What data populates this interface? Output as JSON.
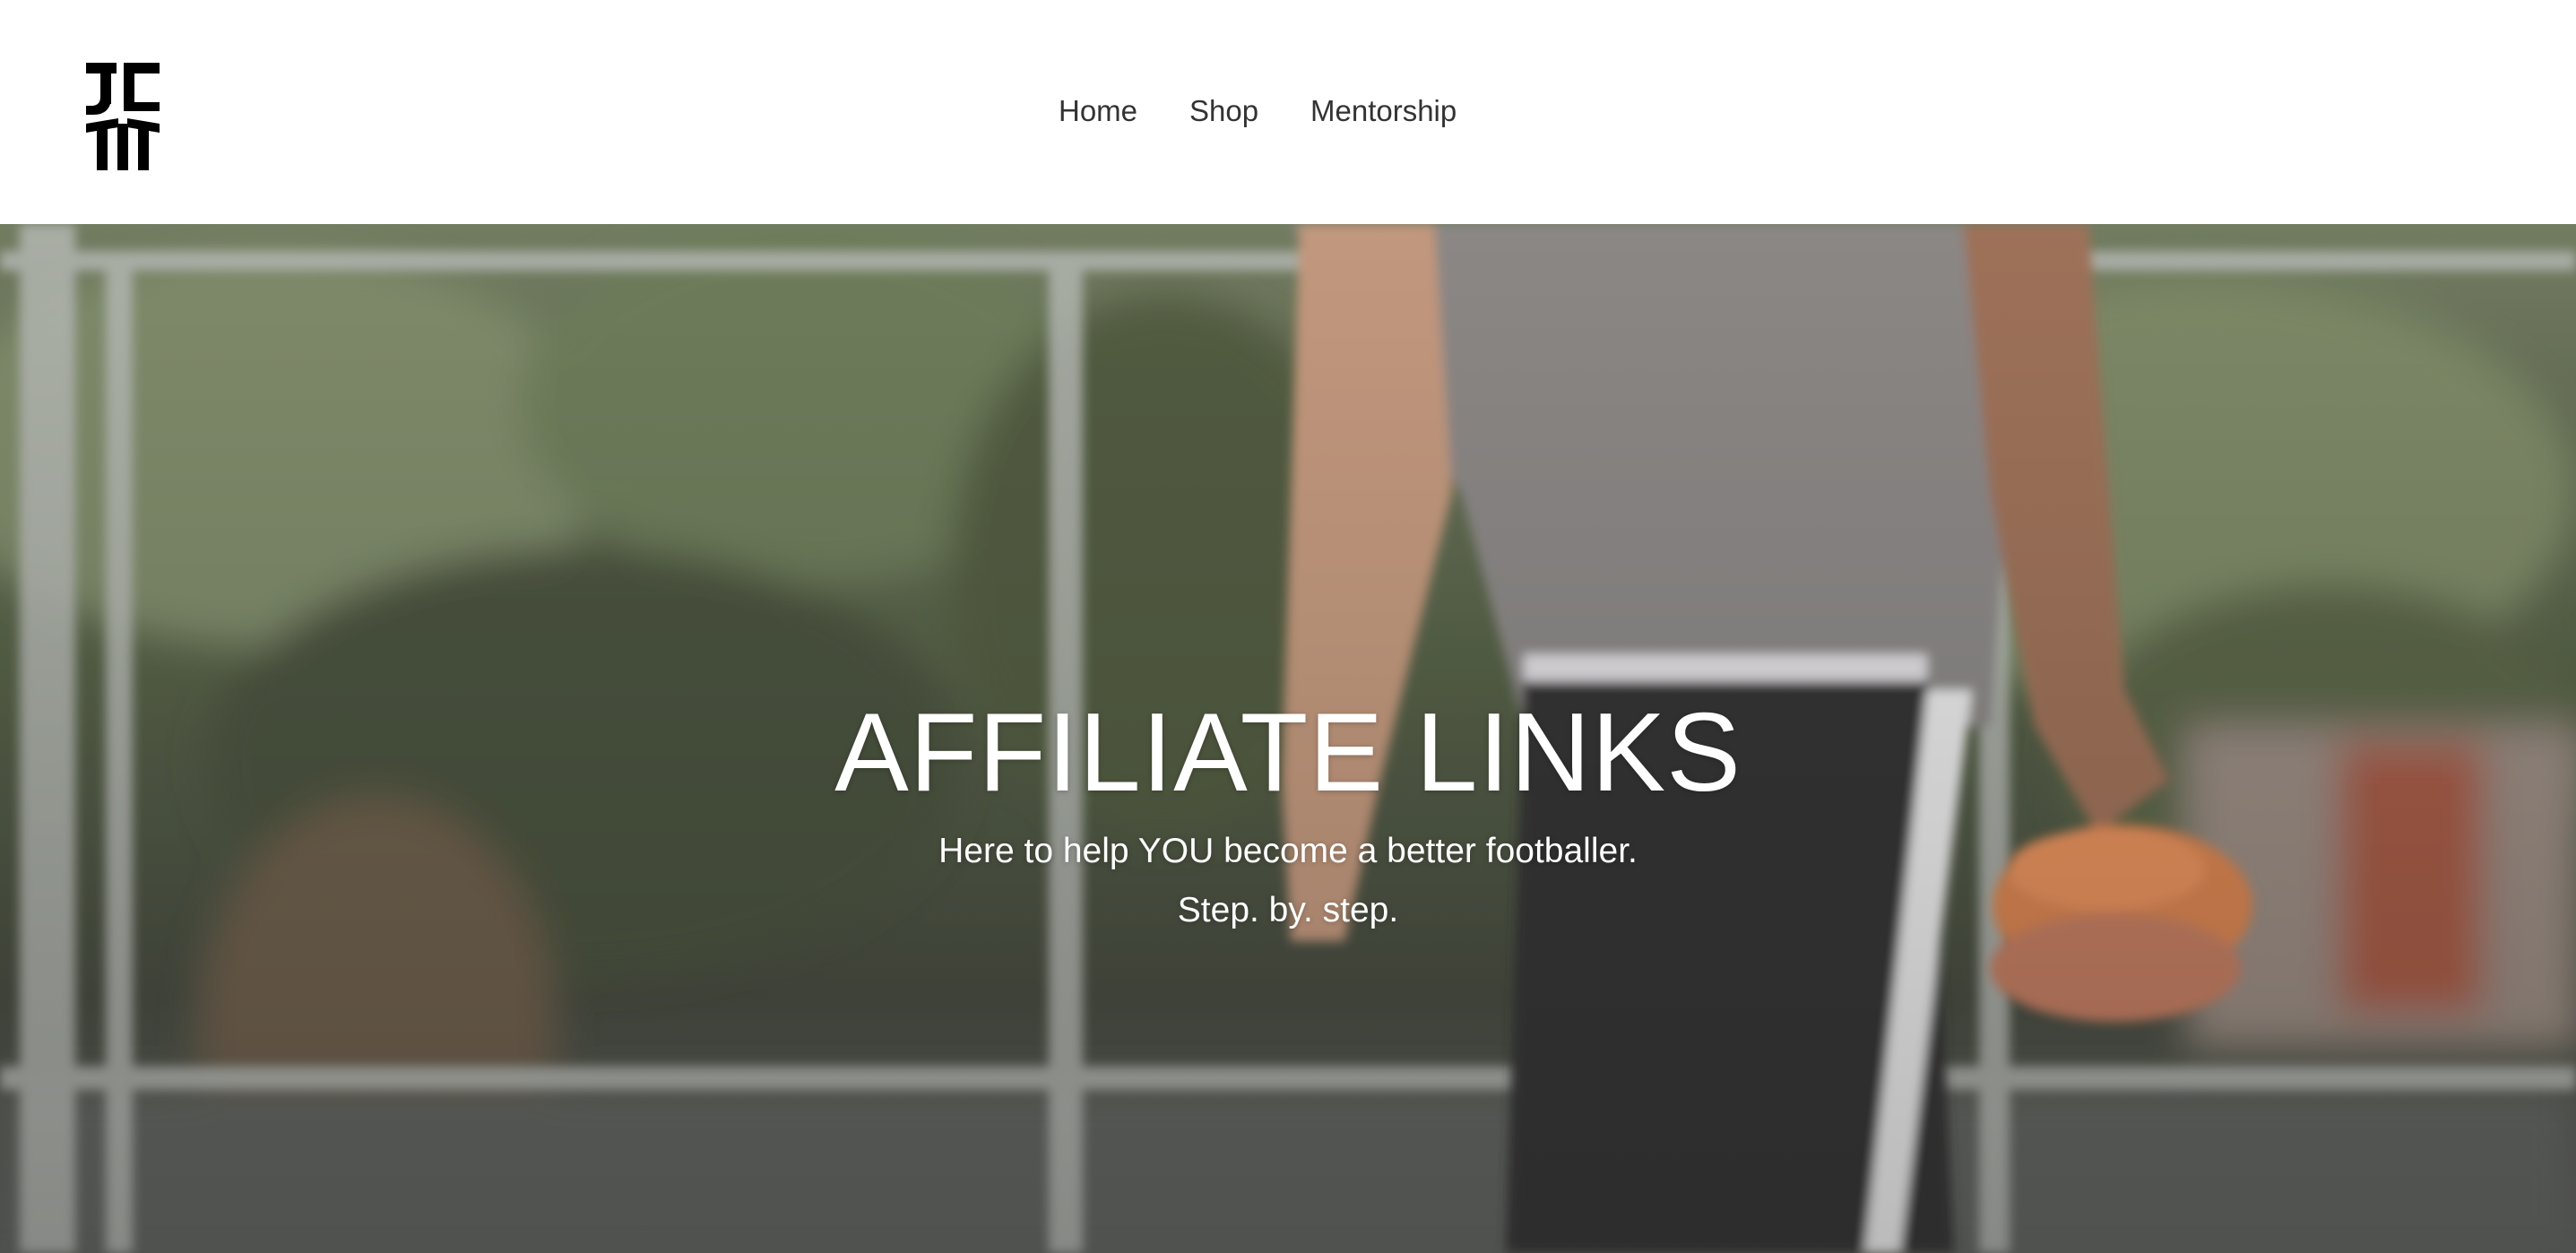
{
  "header": {
    "logo_icon": "jc-logo-icon",
    "nav": [
      {
        "label": "Home"
      },
      {
        "label": "Shop"
      },
      {
        "label": "Mentorship"
      }
    ]
  },
  "hero": {
    "title": "AFFILIATE LINKS",
    "subtitle_line1": "Here to help YOU become a better footballer.",
    "subtitle_line2": "Step. by. step.",
    "background_image": "player-walking-with-cones-image"
  },
  "colors": {
    "nav_text": "#333333",
    "hero_text": "#ffffff",
    "header_bg": "#ffffff"
  }
}
